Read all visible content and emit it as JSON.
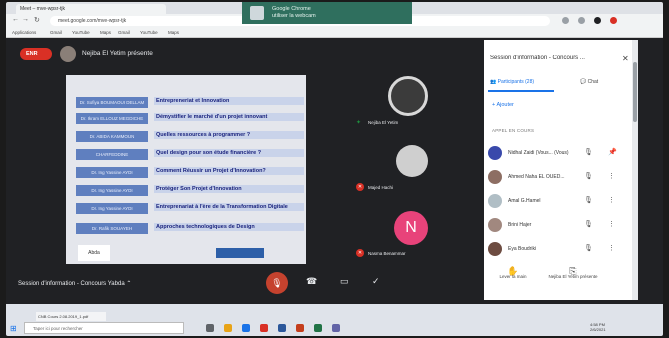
{
  "browser": {
    "tab_title": "Meet – mve-wpsr-tjk",
    "url": "meet.google.com/mve-wpsr-tjk",
    "bookmarks": [
      "Applications",
      "Gmail",
      "YouTube",
      "Maps",
      "Gmail",
      "YouTube",
      "Maps"
    ],
    "notification": {
      "title": "Google Chrome",
      "body": "utiliser la webcam"
    }
  },
  "meet": {
    "rec_label": "ENR",
    "presenter_label": "Nejiba El Yetim présente",
    "meeting_name": "Session d'information - Concours Yabda",
    "slide": {
      "rows": [
        {
          "chip": "Dr. Sofiya BOUMAOUI DELLAM",
          "item": "Entrepreneriat et Innovation"
        },
        {
          "chip": "Dr. Ikram ELLOUZ MEGDICHE",
          "item": "Démystifier le marché d'un projet innovant"
        },
        {
          "chip": "Dr. ABIDA KAMMOUN",
          "item": "Quelles ressources à programmer ?"
        },
        {
          "chip": "CHARFEDDINE",
          "item": "Quel design pour son étude financière ?"
        },
        {
          "chip": "Dr. Ing Yassine AYDI",
          "item": "Comment Réussir un Projet d'Innovation?"
        },
        {
          "chip": "Dr. Ing Yassine AYDI",
          "item": "Protéger Son Projet d'Innovation"
        },
        {
          "chip": "Dr. Ing Yassine AYDI",
          "item": "Entreprenariat à l'ère de la Transformation Digitale"
        },
        {
          "chip": "Dr. Rafik SOUAYEH",
          "item": "Approches technologiques de Design"
        }
      ],
      "logo_text": "Abda"
    },
    "tiles": [
      {
        "name": "Nejiba El Yetim"
      },
      {
        "name": "Majed Hachi"
      },
      {
        "name": "Nasma Benammar",
        "initial": "N"
      }
    ]
  },
  "panel": {
    "title": "Session d'information - Concours ...",
    "tab_participants": "Participants (28)",
    "tab_chat": "Chat",
    "add_label": "Ajouter",
    "section_label": "APPEL EN COURS",
    "participants": [
      {
        "name": "Nidhal Zaidi (Vous...  (Vous)",
        "color": "#3949ab"
      },
      {
        "name": "Ahmed Naha EL OUED...",
        "color": "#8d6e63"
      },
      {
        "name": "Amal G.Hamel",
        "color": "#b0bec5"
      },
      {
        "name": "Brini Hajer",
        "color": "#a1887f"
      },
      {
        "name": "Eya Boudriki",
        "color": "#6d4c41"
      }
    ],
    "raise_hand": "Lever la main",
    "stop_present": "Nejiba El Yetim présente"
  },
  "taskbar": {
    "task_label": "CNB Cours 2.08.2019_1.pdf",
    "search_placeholder": "Taper ici pour rechercher",
    "clock_time": "4:58 PM",
    "clock_date": "2/6/2021"
  }
}
